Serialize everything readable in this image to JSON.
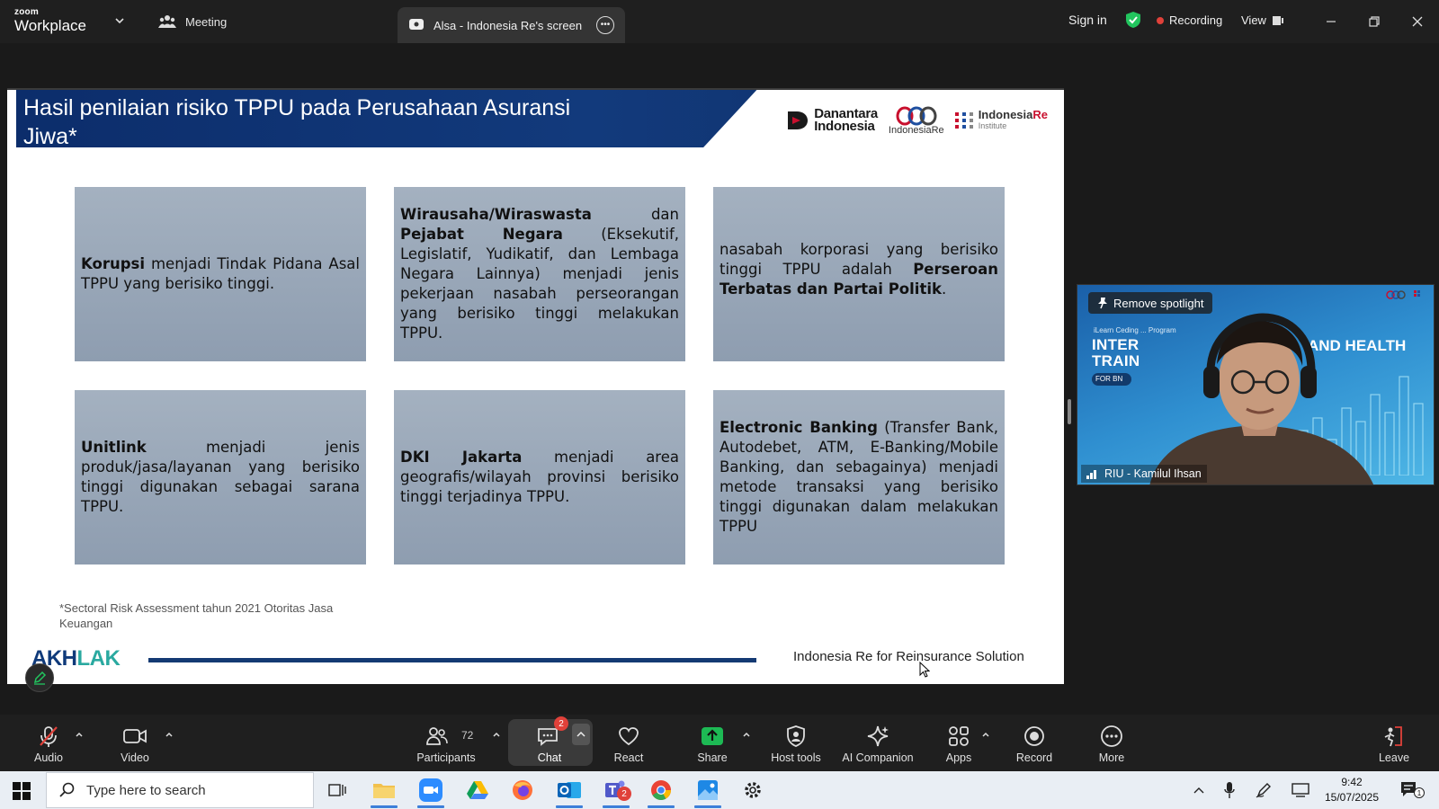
{
  "app": {
    "brand_small": "zoom",
    "brand_big": "Workplace",
    "meeting_tab": "Meeting",
    "share_tab": "Alsa - Indonesia Re's screen",
    "sign_in": "Sign in",
    "recording": "Recording",
    "view": "View"
  },
  "slide": {
    "title": "Hasil penilaian risiko TPPU pada Perusahaan Asuransi Jiwa*",
    "logos": {
      "danantara_line1": "Danantara",
      "danantara_line2": "Indonesia",
      "ire": "IndonesiaRe",
      "inst_a": "Indonesia",
      "inst_b": "Re",
      "inst_c": "Institute"
    },
    "cards": [
      {
        "bold": "Korupsi",
        "text": " menjadi Tindak Pidana Asal TPPU yang berisiko tinggi."
      },
      {
        "bold": "Wirausaha/Wiraswasta",
        "text": " dan ",
        "bold2": "Pejabat Negara",
        "text2": " (Eksekutif, Legislatif, Yudikatif, dan Lembaga Negara Lainnya) menjadi jenis pekerjaan nasabah perseorangan yang berisiko tinggi melakukan TPPU."
      },
      {
        "text": "nasabah korporasi yang berisiko tinggi TPPU adalah ",
        "bold": "Perseroan Terbatas dan Partai Politik",
        "text2": "."
      },
      {
        "bold": "Unitlink",
        "text": " menjadi jenis produk/jasa/layanan yang berisiko tinggi digunakan sebagai sarana TPPU."
      },
      {
        "bold": "DKI Jakarta",
        "text": " menjadi area geografis/wilayah provinsi berisiko tinggi terjadinya TPPU."
      },
      {
        "bold": "Electronic Banking",
        "text": " (Transfer Bank, Autodebet, ATM, E-Banking/Mobile Banking, dan sebagainya) menjadi metode transaksi yang berisiko tinggi digunakan dalam melakukan TPPU"
      }
    ],
    "footnote": "*Sectoral Risk Assessment tahun 2021 Otoritas Jasa Keuangan",
    "akhlak_a": "AKH",
    "akhlak_b": "LAK",
    "footer": "Indonesia Re for Reinsurance Solution"
  },
  "video": {
    "spotlight": "Remove spotlight",
    "name": "RIU - Kamilul Ihsan",
    "bg_small": "iLearn Ceding ... Program",
    "bg_big1": "INTER",
    "bg_big1b": "TRAIN",
    "bg_big2": "AND HEALTH",
    "bg_pill": "FOR BN"
  },
  "toolbar": {
    "audio": "Audio",
    "video": "Video",
    "participants": "Participants",
    "participants_count": "72",
    "chat": "Chat",
    "chat_badge": "2",
    "react": "React",
    "share": "Share",
    "host_tools": "Host tools",
    "ai_companion": "AI Companion",
    "apps": "Apps",
    "record": "Record",
    "more": "More",
    "leave": "Leave"
  },
  "taskbar": {
    "search_placeholder": "Type here to search",
    "teams_badge": "2",
    "time": "9:42",
    "date": "15/07/2025",
    "notif_count": "1"
  },
  "colors": {
    "slide_header": "#0c2d6b",
    "card": "#98a7b9",
    "recording_dot": "#e0413a",
    "share_green": "#1db954",
    "shield_green": "#22c55e"
  }
}
